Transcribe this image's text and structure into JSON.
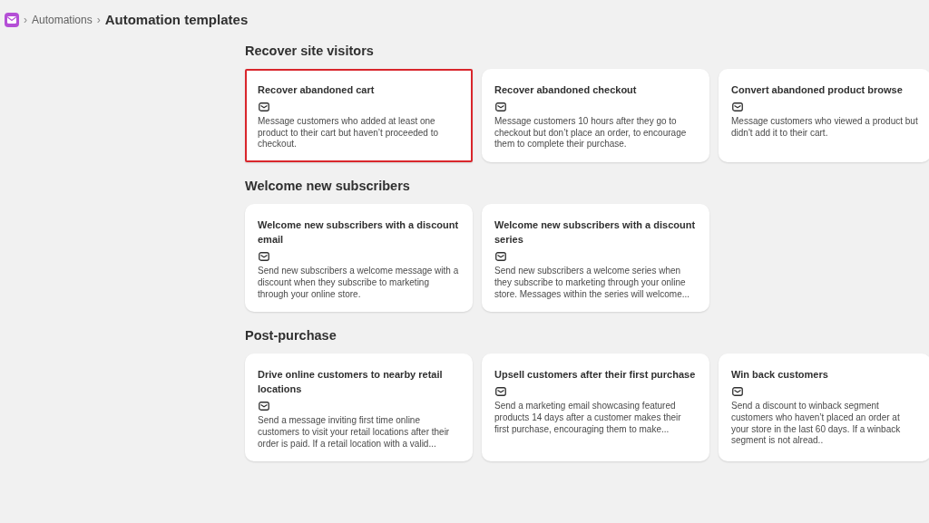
{
  "breadcrumb": {
    "parent": "Automations",
    "separator": "›",
    "title": "Automation templates"
  },
  "sections": [
    {
      "title": "Recover site visitors",
      "cards": [
        {
          "title": "Recover abandoned cart",
          "description": "Message customers who added at least one product to their cart but haven’t proceeded to checkout.",
          "highlighted": true
        },
        {
          "title": "Recover abandoned checkout",
          "description": "Message customers 10 hours after they go to checkout but don’t place an order, to encourage them to complete their purchase.",
          "highlighted": false
        },
        {
          "title": "Convert abandoned product browse",
          "description": "Message customers who viewed a product but didn't add it to their cart.",
          "highlighted": false
        }
      ]
    },
    {
      "title": "Welcome new subscribers",
      "cards": [
        {
          "title": "Welcome new subscribers with a discount email",
          "description": "Send new subscribers a welcome message with a discount when they subscribe to marketing through your online store.",
          "highlighted": false
        },
        {
          "title": "Welcome new subscribers with a discount series",
          "description": "Send new subscribers a welcome series when they subscribe to marketing through your online store. Messages within the series will welcome...",
          "highlighted": false
        }
      ]
    },
    {
      "title": "Post-purchase",
      "cards": [
        {
          "title": "Drive online customers to nearby retail locations",
          "description": "Send a message inviting first time online customers to visit your retail locations after their order is paid. If a retail location with a valid...",
          "highlighted": false
        },
        {
          "title": "Upsell customers after their first purchase",
          "description": "Send a marketing email showcasing featured products 14 days after a customer makes their first purchase, encouraging them to make...",
          "highlighted": false
        },
        {
          "title": "Win back customers",
          "description": "Send a discount to winback segment customers who haven’t placed an order at your store in the last 60 days. If a winback segment is not alread..",
          "highlighted": false
        }
      ]
    }
  ]
}
